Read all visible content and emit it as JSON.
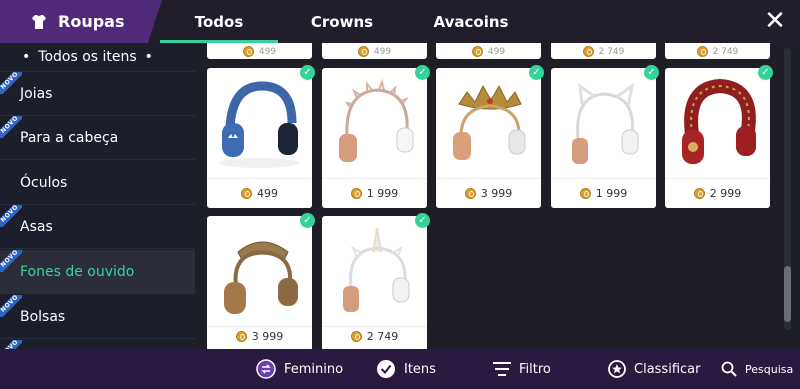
{
  "header": {
    "title": "Roupas",
    "close_symbol": "✕",
    "tabs": [
      {
        "label": "Todos",
        "active": true
      },
      {
        "label": "Crowns",
        "active": false
      },
      {
        "label": "Avacoins",
        "active": false
      }
    ]
  },
  "sidebar": {
    "new_badge": "NOVO",
    "items": [
      {
        "label": "Todos os itens",
        "new": false,
        "active": false
      },
      {
        "label": "Joias",
        "new": true,
        "active": false
      },
      {
        "label": "Para a cabeça",
        "new": true,
        "active": false
      },
      {
        "label": "Óculos",
        "new": false,
        "active": false
      },
      {
        "label": "Asas",
        "new": true,
        "active": false
      },
      {
        "label": "Fones de ouvido",
        "new": true,
        "active": true
      },
      {
        "label": "Bolsas",
        "new": true,
        "active": false
      }
    ]
  },
  "products": {
    "partial_row_prices": [
      "499",
      "499",
      "499",
      "2 749",
      "2 749"
    ],
    "items": [
      {
        "name": "blue-crown-headphones",
        "price": "499",
        "owned": true
      },
      {
        "name": "spiked-headphones",
        "price": "1 999",
        "owned": true
      },
      {
        "name": "crown-headphones",
        "price": "3 999",
        "owned": true
      },
      {
        "name": "cat-ear-headphones",
        "price": "1 999",
        "owned": true
      },
      {
        "name": "red-ornate-headphones",
        "price": "2 999",
        "owned": true
      },
      {
        "name": "bronze-tiara-headphones",
        "price": "3 999",
        "owned": true
      },
      {
        "name": "unicorn-headphones",
        "price": "2 749",
        "owned": true
      }
    ]
  },
  "bottom_bar": {
    "feminino": "Feminino",
    "itens": "Itens",
    "filtro": "Filtro",
    "classificar": "Classificar",
    "pesquisa": "Pesquisa"
  },
  "colors": {
    "accent_green": "#35d39a",
    "header_purple": "#4f2a78",
    "bottom_bar": "#2b1a40",
    "new_badge": "#2f63c4",
    "coin": "#d8a138"
  }
}
